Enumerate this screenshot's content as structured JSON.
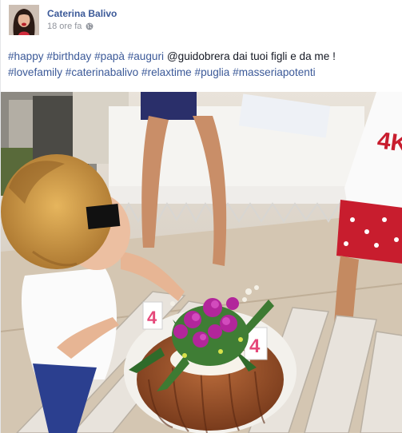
{
  "post": {
    "author": "Caterina Balivo",
    "timestamp": "18 ore fa",
    "audience_icon": "globe-icon",
    "message": {
      "line1": {
        "tags": [
          "#happy",
          "#birthday",
          "#papà",
          "#auguri"
        ],
        "mention": "@guidobrera",
        "text": "dai tuoi figli e da me !"
      },
      "line2": {
        "tags": [
          "#lovefamily",
          "#caterinabalivo",
          "#relaxtime",
          "#puglia",
          "#masseriapotenti"
        ]
      }
    },
    "photo": {
      "cake_candle_digits": [
        "4",
        "4"
      ],
      "shirt_print": "4K"
    }
  }
}
